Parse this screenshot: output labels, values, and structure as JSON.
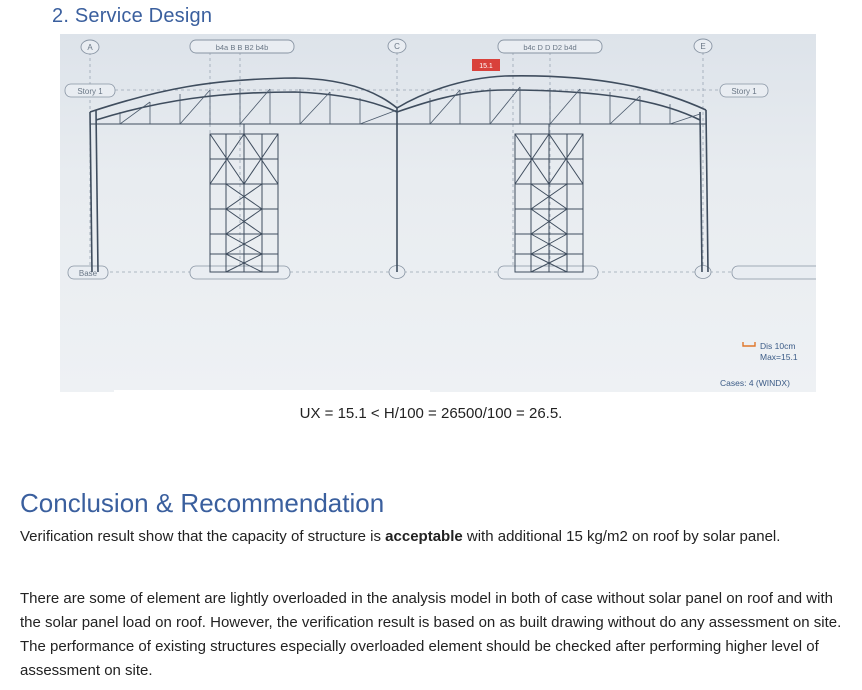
{
  "heading_service": "2. Service Design",
  "figure": {
    "grid_top": [
      "A",
      "C",
      "E"
    ],
    "grid_top_groups": [
      "b4a",
      "B",
      "B",
      "B2",
      "b4b",
      "b4c",
      "D",
      "D",
      "D2",
      "b4d"
    ],
    "story_left": "Story 1",
    "story_right": "Story 1",
    "base_left": "Base",
    "marker_value": "15.1",
    "legend_dis": "Dis  10cm",
    "legend_max": "Max=15.1",
    "cases": "Cases: 4 (WINDX)",
    "colors": {
      "structure": "#3f4d5e",
      "marker": "#d9413b",
      "legend_accent": "#e0772a",
      "legend_text": "#3b5b86"
    }
  },
  "formula": "UX = 15.1 < H/100 = 26500/100 = 26.5.",
  "heading_conclusion": "Conclusion & Recommendation",
  "para1": {
    "before": "Verification result show that the capacity of structure is ",
    "bold": "acceptable",
    "after": " with additional 15 kg/m2 on roof by solar panel."
  },
  "para2": "There are some of element are lightly overloaded in the analysis model in both of case without solar panel on roof and with the solar panel load on roof. However, the verification result is based on as built drawing without do any assessment on site. The performance of existing structures especially overloaded element should be checked after performing higher level of assessment on site."
}
